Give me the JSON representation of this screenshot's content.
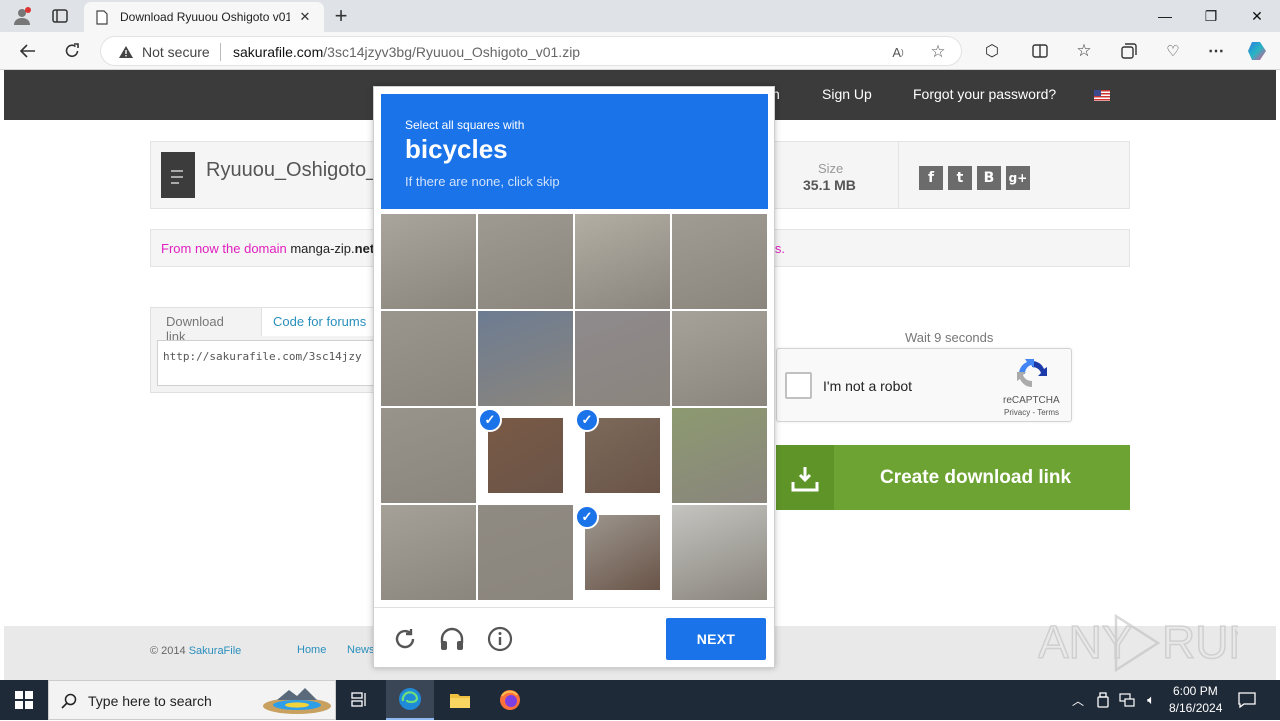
{
  "browser": {
    "tab_title": "Download Ryuuou Oshigoto v01",
    "security_label": "Not secure",
    "url_domain": "sakurafile.com",
    "url_path": "/3sc14jzyv3bg/Ryuuou_Oshigoto_v01.zip",
    "new_tab": "+",
    "minimize": "—",
    "maximize": "❐",
    "close": "✕"
  },
  "site": {
    "header_partial": "n",
    "sign_up": "Sign Up",
    "forgot_password": "Forgot your password?",
    "file_name": "Ryuuou_Oshigoto_v",
    "size_label": "Size",
    "size_value": "35.1 MB",
    "social": [
      "f",
      "t",
      "B",
      "g+"
    ],
    "notice_prefix": "From now the domain ",
    "notice_domain": "manga-zip.",
    "notice_domain_bold": "net",
    "notice_suffix": "rks.",
    "tabs": [
      "Download link",
      "Code for forums"
    ],
    "link_value": "http://sakurafile.com/3sc14jzy",
    "wait_text": "Wait 9 seconds",
    "create_button": "Create download link",
    "footer_copyright": "© 2014 ",
    "footer_brand": "SakuraFile",
    "footer_links": [
      "Home",
      "News"
    ]
  },
  "recaptcha_widget": {
    "label": "I'm not a robot",
    "brand": "reCAPTCHA",
    "privacy": "Privacy",
    "sep": " - ",
    "terms": "Terms"
  },
  "challenge": {
    "instruction": "Select all squares with",
    "keyword": "bicycles",
    "subtext": "If there are none, click skip",
    "selected_tiles": [
      9,
      10,
      14
    ],
    "next_button": "NEXT"
  },
  "taskbar": {
    "search_placeholder": "Type here to search",
    "time": "6:00 PM",
    "date": "8/16/2024"
  },
  "watermark": "ANY RUN",
  "colors": {
    "accent": "#1a73e8",
    "create_green": "#6da332",
    "notice_magenta": "#e020c0",
    "header_dark": "#3b3b3b"
  }
}
